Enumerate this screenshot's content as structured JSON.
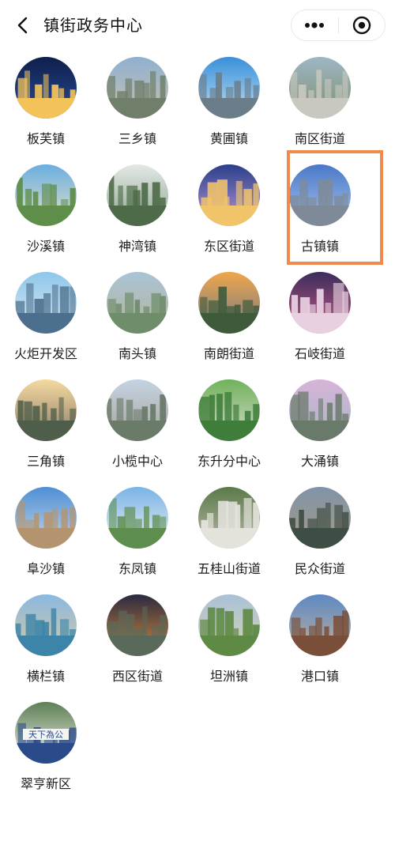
{
  "header": {
    "title": "镇街政务中心",
    "back_icon": "chevron-left-icon",
    "more_icon": "more-dots-icon",
    "close_icon": "mini-program-close-icon"
  },
  "highlight_color": "#f08a4b",
  "towns": [
    {
      "label": "板芙镇",
      "scene": "night-city",
      "colors": [
        "#0e1f4a",
        "#2a4d9a",
        "#f3c35a"
      ]
    },
    {
      "label": "三乡镇",
      "scene": "dense-city",
      "colors": [
        "#8fb0d0",
        "#c9c2b0",
        "#6f7f6a"
      ]
    },
    {
      "label": "黄圃镇",
      "scene": "skyline-water",
      "colors": [
        "#3a8fd8",
        "#bfe3f8",
        "#6c7d8a"
      ]
    },
    {
      "label": "南区街道",
      "scene": "aerial-lake",
      "colors": [
        "#9fb6c6",
        "#7b8f6a",
        "#c8c8c0"
      ]
    },
    {
      "label": "沙溪镇",
      "scene": "green-town",
      "colors": [
        "#6aaee0",
        "#e7e2c8",
        "#5f8e4a"
      ]
    },
    {
      "label": "神湾镇",
      "scene": "misty-hills",
      "colors": [
        "#e4e8e6",
        "#8aa58a",
        "#4d6b48"
      ]
    },
    {
      "label": "东区街道",
      "scene": "towers-dusk",
      "colors": [
        "#2c3f8a",
        "#b99ad8",
        "#f2c46a"
      ]
    },
    {
      "label": "古镇镇",
      "scene": "twin-towers",
      "colors": [
        "#4a78c8",
        "#a8c6ee",
        "#7e8a98"
      ]
    },
    {
      "label": "火炬开发区",
      "scene": "modern-glass",
      "colors": [
        "#8ec6ea",
        "#dfeaf2",
        "#4b6f8c"
      ]
    },
    {
      "label": "南头镇",
      "scene": "aerial-river",
      "colors": [
        "#a9c3d6",
        "#b7b49a",
        "#6e8d6a"
      ]
    },
    {
      "label": "南朗街道",
      "scene": "sunset-coast",
      "colors": [
        "#f0a64a",
        "#6b7a8c",
        "#3e5a3a"
      ]
    },
    {
      "label": "石岐街道",
      "scene": "ferris-wheel",
      "colors": [
        "#3b2d5a",
        "#c85a8a",
        "#e8d0e0"
      ]
    },
    {
      "label": "三角镇",
      "scene": "sunrise-plain",
      "colors": [
        "#f5d9a0",
        "#8a7a66",
        "#4f5e4a"
      ]
    },
    {
      "label": "小榄中心",
      "scene": "dense-towers",
      "colors": [
        "#c4d4e2",
        "#a8a29a",
        "#6a7b6a"
      ]
    },
    {
      "label": "东升分中心",
      "scene": "interchange",
      "colors": [
        "#6fb35a",
        "#d8d8d0",
        "#3f7d3a"
      ]
    },
    {
      "label": "大涌镇",
      "scene": "pink-sky",
      "colors": [
        "#d8b4d8",
        "#a7b6c8",
        "#6a7a6a"
      ]
    },
    {
      "label": "阜沙镇",
      "scene": "blue-town",
      "colors": [
        "#4e8fd6",
        "#cbd9e2",
        "#b4946e"
      ]
    },
    {
      "label": "东凤镇",
      "scene": "plaza-building",
      "colors": [
        "#79b4e8",
        "#f0f0ec",
        "#5e8e4e"
      ]
    },
    {
      "label": "五桂山街道",
      "scene": "stone-gate",
      "colors": [
        "#5a7a4a",
        "#b9b9a8",
        "#e3e3dc"
      ]
    },
    {
      "label": "民众街道",
      "scene": "canal-village",
      "colors": [
        "#7f93a8",
        "#a89a84",
        "#3f4e44"
      ]
    },
    {
      "label": "横栏镇",
      "scene": "river-town",
      "colors": [
        "#8ab8e0",
        "#d9c9a0",
        "#3c84a8"
      ]
    },
    {
      "label": "西区街道",
      "scene": "night-road",
      "colors": [
        "#2a2a40",
        "#d88a3a",
        "#5a6a5a"
      ]
    },
    {
      "label": "坦洲镇",
      "scene": "roundabout",
      "colors": [
        "#a9c2d8",
        "#d6d0b0",
        "#5e8a46"
      ]
    },
    {
      "label": "港口镇",
      "scene": "old-town",
      "colors": [
        "#5e88c4",
        "#c0b49c",
        "#7a4f3a"
      ]
    },
    {
      "label": "翠亨新区",
      "scene": "archway",
      "colors": [
        "#5e7f54",
        "#f2f2ee",
        "#2a4a8a"
      ]
    }
  ],
  "arch_text": "天下為公"
}
